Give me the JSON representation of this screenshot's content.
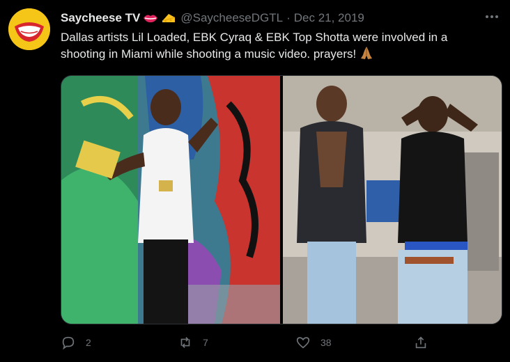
{
  "tweet": {
    "author": {
      "name": "Saycheese TV",
      "name_emoji": [
        "lips-emoji",
        "cheese-emoji"
      ],
      "handle": "@SaycheeseDGTL",
      "separator": "·",
      "avatar_icon": "saycheese-logo"
    },
    "date": "Dec 21, 2019",
    "text": "Dallas artists Lil Loaded, EBK Cyraq & EBK Top Shotta were involved in a shooting in Miami while shooting a music video. prayers!",
    "text_emoji": "folded-hands-emoji",
    "media": [
      {
        "icon": "photo-graffiti-wall"
      },
      {
        "icon": "photo-two-men-garage"
      }
    ],
    "more_icon": "more-dots-icon",
    "actions": {
      "reply": {
        "icon": "reply-icon",
        "count": "2"
      },
      "retweet": {
        "icon": "retweet-icon",
        "count": "7"
      },
      "like": {
        "icon": "heart-icon",
        "count": "38"
      },
      "share": {
        "icon": "share-icon",
        "count": ""
      }
    },
    "colors": {
      "background": "#000000",
      "primary_text": "#e7e9ea",
      "secondary_text": "#71767b",
      "avatar_bg": "#f5c518"
    }
  }
}
